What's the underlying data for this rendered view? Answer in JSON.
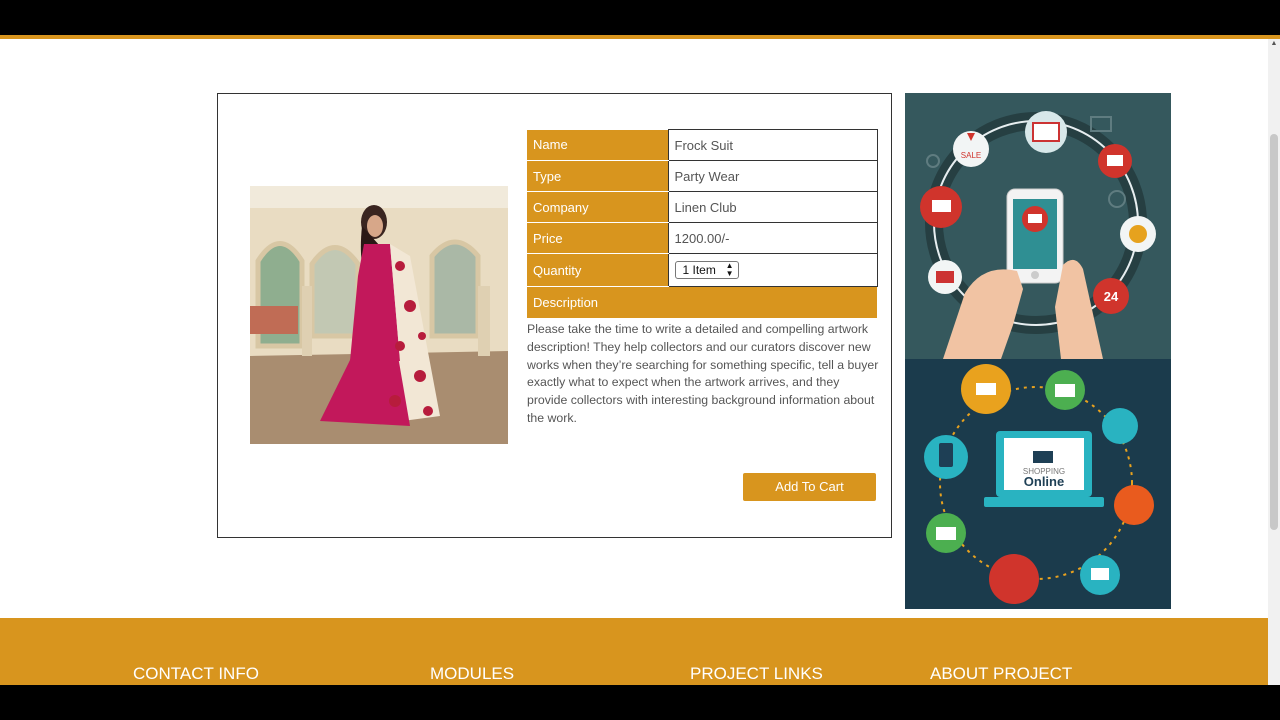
{
  "product": {
    "fields": [
      {
        "key": "Name",
        "value": "Frock Suit"
      },
      {
        "key": "Type",
        "value": "Party Wear"
      },
      {
        "key": "Company",
        "value": "Linen Club"
      },
      {
        "key": "Price",
        "value": "1200.00/-"
      }
    ],
    "quantity_label": "Quantity",
    "quantity_value": "1 Item",
    "description_label": "Description",
    "description_text": "Please take the time to write a detailed and compelling artwork description! They help collectors and our curators discover new works when they’re searching for something specific, tell a buyer exactly what to expect when the artwork arrives, and they provide collectors with interesting background information about the work.",
    "add_to_cart_label": "Add To Cart"
  },
  "ad": {
    "sale_text": "SALE",
    "shopping_text": "SHOPPING",
    "online_text": "Online",
    "clock_text": "24"
  },
  "footer": {
    "contact": "CONTACT INFO",
    "modules": "MODULES",
    "project_links": "PROJECT LINKS",
    "about": "ABOUT PROJECT"
  },
  "colors": {
    "accent": "#d8951e",
    "ad_top": "#35585d",
    "ad_bottom": "#1b3b4c"
  }
}
